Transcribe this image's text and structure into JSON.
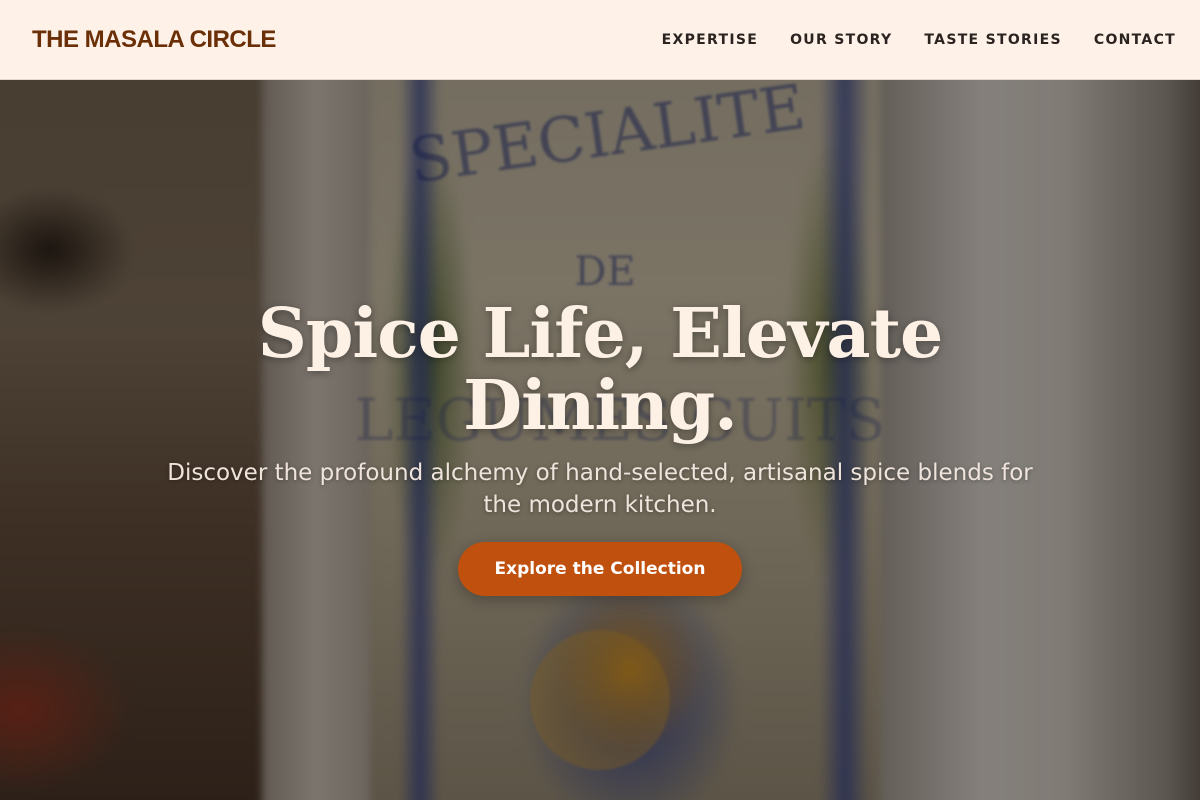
{
  "header": {
    "brand": "THE MASALA CIRCLE",
    "nav": [
      {
        "label": "EXPERTISE"
      },
      {
        "label": "OUR STORY"
      },
      {
        "label": "TASTE STORIES"
      },
      {
        "label": "CONTACT"
      }
    ]
  },
  "hero": {
    "title": "Spice Life, Elevate Dining.",
    "subtitle": "Discover the profound alchemy of hand-selected, artisanal spice blends for the modern kitchen.",
    "cta_label": "Explore the Collection",
    "background_sign_text": [
      "SPECIALITE",
      "DE",
      "LEGUMES CUITS"
    ]
  },
  "colors": {
    "header_bg": "#fdf1e8",
    "brand": "#6b2f07",
    "nav_text": "#2b2320",
    "title_text": "#fdf1e6",
    "cta_bg": "#c0500d",
    "cta_text": "#ffffff"
  }
}
